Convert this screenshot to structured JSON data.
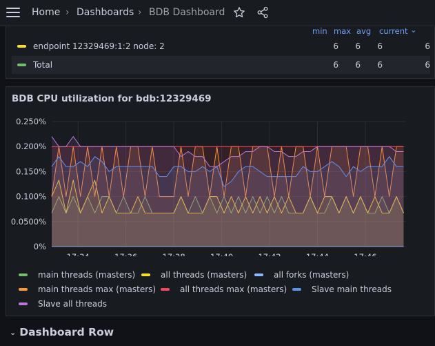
{
  "breadcrumb": {
    "home": "Home",
    "dashboards": "Dashboards",
    "current": "BDB Dashboard",
    "separator": "›"
  },
  "legend_table": {
    "columns": [
      "min",
      "max",
      "avg",
      "current"
    ],
    "current_chevron": "⌄",
    "rows": [
      {
        "name": "endpoint 12329469:1:2 node: 2",
        "color": "#fade2a",
        "min": "6",
        "max": "6",
        "avg": "6",
        "current": "6"
      },
      {
        "name": "Total",
        "color": "#73bf69",
        "min": "6",
        "max": "6",
        "avg": "6",
        "current": "6"
      }
    ]
  },
  "panel": {
    "title": "BDB CPU utilization for bdb:12329469"
  },
  "chart_data": {
    "type": "area",
    "title": "BDB CPU utilization for bdb:12329469",
    "ylim": [
      0,
      0.25
    ],
    "y_ticks": [
      "0%",
      "0.0500%",
      "0.100%",
      "0.150%",
      "0.200%",
      "0.250%"
    ],
    "x_ticks": [
      "17:34",
      "17:36",
      "17:38",
      "17:40",
      "17:42",
      "17:44",
      "17:46"
    ],
    "xlim_minutes": [
      32.9,
      47.7
    ],
    "grid": true,
    "legend_placement": "bottom",
    "x": [
      32.9,
      33.2,
      33.5,
      33.8,
      34.1,
      34.4,
      34.7,
      35.0,
      35.3,
      35.6,
      35.9,
      36.2,
      36.5,
      36.8,
      37.1,
      37.4,
      37.7,
      38.0,
      38.3,
      38.6,
      38.9,
      39.2,
      39.5,
      39.8,
      40.1,
      40.4,
      40.7,
      41.0,
      41.3,
      41.6,
      41.9,
      42.2,
      42.5,
      42.8,
      43.1,
      43.4,
      43.7,
      44.0,
      44.3,
      44.6,
      44.9,
      45.2,
      45.5,
      45.8,
      46.1,
      46.4,
      46.7,
      47.0,
      47.3,
      47.6
    ],
    "series": [
      {
        "name": "main threads (masters)",
        "color": "#73bf69",
        "values": [
          0.067,
          0.1,
          0.067,
          0.1,
          0.067,
          0.1,
          0.067,
          0.1,
          0.1,
          0.067,
          0.1,
          0.067,
          0.067,
          0.1,
          0.067,
          0.067,
          0.067,
          0.067,
          0.1,
          0.067,
          0.1,
          0.067,
          0.1,
          0.067,
          0.1,
          0.067,
          0.1,
          0.067,
          0.1,
          0.067,
          0.1,
          0.067,
          0.1,
          0.067,
          0.067,
          0.067,
          0.1,
          0.067,
          0.067,
          0.1,
          0.067,
          0.1,
          0.067,
          0.1,
          0.067,
          0.067,
          0.1,
          0.067,
          0.1,
          0.067
        ]
      },
      {
        "name": "all threads (masters)",
        "color": "#fade2a",
        "values": [
          0.1,
          0.133,
          0.067,
          0.133,
          0.067,
          0.1,
          0.133,
          0.067,
          0.1,
          0.067,
          0.067,
          0.067,
          0.1,
          0.067,
          0.067,
          0.067,
          0.067,
          0.067,
          0.1,
          0.067,
          0.067,
          0.067,
          0.1,
          0.1,
          0.067,
          0.1,
          0.067,
          0.1,
          0.067,
          0.1,
          0.067,
          0.1,
          0.067,
          0.1,
          0.067,
          0.067,
          0.1,
          0.067,
          0.1,
          0.1,
          0.067,
          0.1,
          0.067,
          0.1,
          0.067,
          0.1,
          0.067,
          0.067,
          0.1,
          0.067
        ]
      },
      {
        "name": "all forks (masters)",
        "color": "#8ab8ff",
        "values": [
          0,
          0,
          0,
          0,
          0,
          0,
          0,
          0,
          0,
          0,
          0,
          0,
          0,
          0,
          0,
          0,
          0,
          0,
          0,
          0,
          0,
          0,
          0,
          0,
          0,
          0,
          0,
          0,
          0,
          0,
          0,
          0,
          0,
          0,
          0,
          0,
          0,
          0,
          0,
          0,
          0,
          0,
          0,
          0,
          0,
          0,
          0,
          0,
          0,
          0
        ]
      },
      {
        "name": "main threads max (masters)",
        "color": "#ff9830",
        "values": [
          0.1,
          0.2,
          0.1,
          0.2,
          0.1,
          0.2,
          0.1,
          0.2,
          0.1,
          0.2,
          0.1,
          0.2,
          0.2,
          0.1,
          0.2,
          0.1,
          0.1,
          0.1,
          0.2,
          0.1,
          0.2,
          0.2,
          0.1,
          0.2,
          0.1,
          0.2,
          0.2,
          0.1,
          0.2,
          0.2,
          0.2,
          0.1,
          0.2,
          0.1,
          0.2,
          0.2,
          0.1,
          0.2,
          0.1,
          0.2,
          0.2,
          0.2,
          0.1,
          0.2,
          0.2,
          0.1,
          0.2,
          0.1,
          0.2,
          0.2
        ]
      },
      {
        "name": "all threads max (masters)",
        "color": "#f2495c",
        "values": [
          0.2,
          0.2,
          0.2,
          0.2,
          0.2,
          0.2,
          0.2,
          0.2,
          0.2,
          0.2,
          0.2,
          0.2,
          0.2,
          0.2,
          0.2,
          0.2,
          0.2,
          0.2,
          0.2,
          0.2,
          0.2,
          0.2,
          0.2,
          0.2,
          0.2,
          0.2,
          0.2,
          0.2,
          0.2,
          0.2,
          0.2,
          0.2,
          0.2,
          0.2,
          0.2,
          0.2,
          0.2,
          0.2,
          0.2,
          0.2,
          0.2,
          0.2,
          0.2,
          0.2,
          0.2,
          0.2,
          0.2,
          0.2,
          0.2,
          0.2
        ]
      },
      {
        "name": "Slave main threads",
        "color": "#5794f2",
        "values": [
          0.16,
          0.18,
          0.16,
          0.16,
          0.17,
          0.16,
          0.18,
          0.17,
          0.15,
          0.16,
          0.16,
          0.16,
          0.16,
          0.16,
          0.16,
          0.14,
          0.14,
          0.16,
          0.16,
          0.15,
          0.15,
          0.16,
          0.15,
          0.16,
          0.12,
          0.13,
          0.15,
          0.16,
          0.16,
          0.15,
          0.14,
          0.14,
          0.14,
          0.14,
          0.14,
          0.16,
          0.15,
          0.15,
          0.16,
          0.17,
          0.16,
          0.14,
          0.16,
          0.15,
          0.16,
          0.16,
          0.16,
          0.18,
          0.16,
          0.16
        ]
      },
      {
        "name": "Slave all threads",
        "color": "#b877d9",
        "values": [
          0.22,
          0.2,
          0.2,
          0.22,
          0.2,
          0.2,
          0.2,
          0.2,
          0.2,
          0.2,
          0.2,
          0.2,
          0.2,
          0.2,
          0.2,
          0.2,
          0.2,
          0.2,
          0.18,
          0.19,
          0.18,
          0.18,
          0.16,
          0.16,
          0.17,
          0.18,
          0.18,
          0.19,
          0.19,
          0.2,
          0.2,
          0.19,
          0.19,
          0.18,
          0.18,
          0.19,
          0.19,
          0.2,
          0.2,
          0.2,
          0.2,
          0.2,
          0.2,
          0.2,
          0.2,
          0.2,
          0.2,
          0.2,
          0.19,
          0.19
        ]
      }
    ]
  },
  "row_header": {
    "chevron": "⌄",
    "label": "Dashboard Row"
  }
}
